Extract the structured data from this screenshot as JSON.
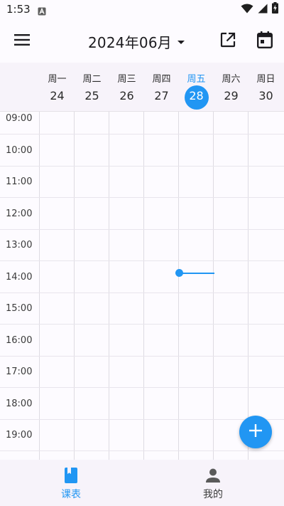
{
  "status_bar": {
    "time": "1:53",
    "notification_icon": "a-badge-icon",
    "wifi_icon": "wifi-icon",
    "signal_icon": "signal-icon",
    "battery_icon": "battery-charging-icon"
  },
  "app_bar": {
    "menu_icon": "menu-icon",
    "title": "2024年06月",
    "dropdown_icon": "dropdown-arrow-icon",
    "open_external_icon": "open-in-new-icon",
    "calendar_icon": "calendar-today-icon"
  },
  "week": {
    "days": [
      {
        "name": "周一",
        "date": "24",
        "today": false
      },
      {
        "name": "周二",
        "date": "25",
        "today": false
      },
      {
        "name": "周三",
        "date": "26",
        "today": false
      },
      {
        "name": "周四",
        "date": "27",
        "today": false
      },
      {
        "name": "周五",
        "date": "28",
        "today": true
      },
      {
        "name": "周六",
        "date": "29",
        "today": false
      },
      {
        "name": "周日",
        "date": "30",
        "today": false
      }
    ]
  },
  "timetable": {
    "hours": [
      "09:00",
      "10:00",
      "11:00",
      "12:00",
      "13:00",
      "14:00",
      "15:00",
      "16:00",
      "17:00",
      "18:00",
      "19:00"
    ]
  },
  "fab": {
    "icon": "add-icon"
  },
  "bottom_nav": {
    "items": [
      {
        "label": "课表",
        "icon": "book-icon",
        "selected": true
      },
      {
        "label": "我的",
        "icon": "person-icon",
        "selected": false
      }
    ]
  },
  "colors": {
    "accent": "#2196f3",
    "surface": "#fdfbff",
    "header_surface": "#f7f3fa",
    "nav_inactive": "#3a3a3a"
  }
}
